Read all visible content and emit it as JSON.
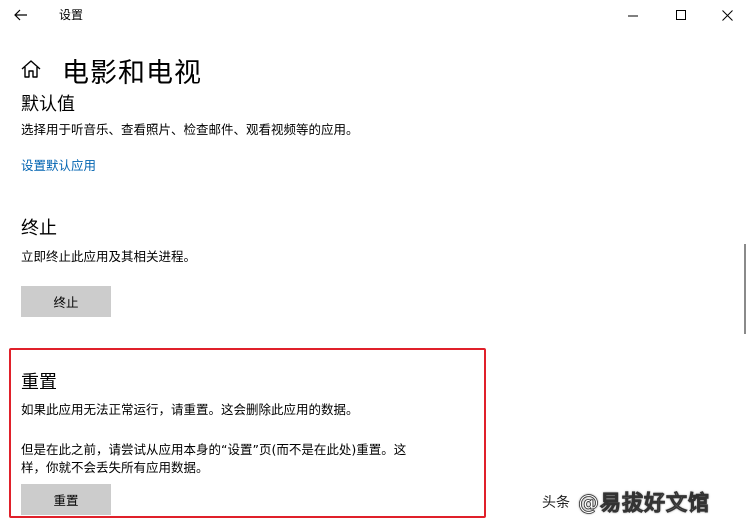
{
  "window": {
    "title": "设置"
  },
  "page": {
    "title": "电影和电视"
  },
  "default_section": {
    "title": "默认值",
    "description": "选择用于听音乐、查看照片、检查邮件、观看视频等的应用。",
    "link": "设置默认应用"
  },
  "terminate_section": {
    "title": "终止",
    "description": "立即终止此应用及其相关进程。",
    "button": "终止"
  },
  "reset_section": {
    "title": "重置",
    "description1": "如果此应用无法正常运行，请重置。这会删除此应用的数据。",
    "description2_line1": "但是在此之前，请尝试从应用本身的“设置”页(而不是在此处)重置。这",
    "description2_line2": "样，你就不会丢失所有应用数据。",
    "button": "重置"
  },
  "watermark": {
    "source": "头条",
    "author": "@易拔好文馆"
  },
  "colors": {
    "link": "#0063b1",
    "button_bg": "#cccccc",
    "highlight": "#e0202a"
  }
}
